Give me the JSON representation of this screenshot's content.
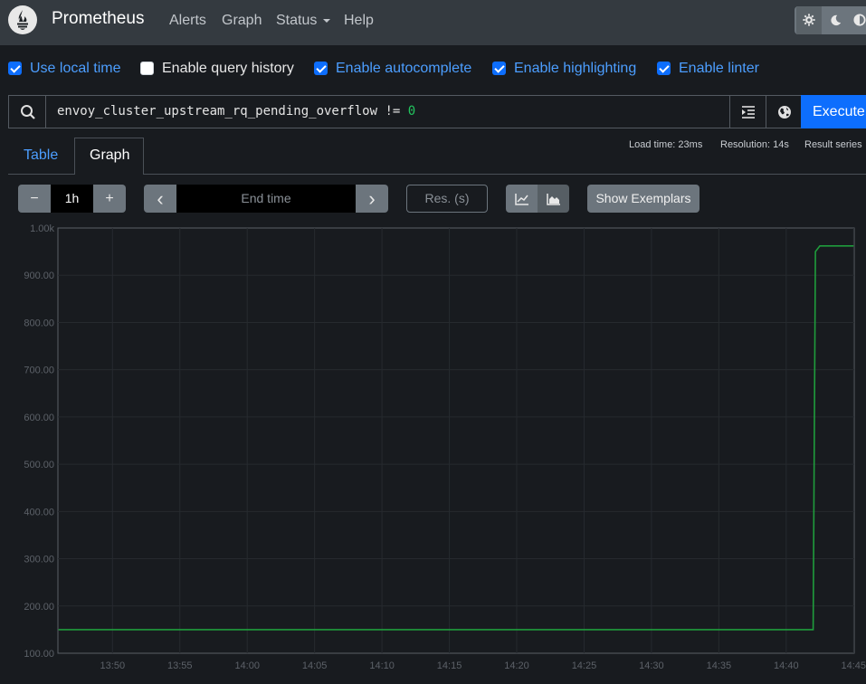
{
  "navbar": {
    "brand": "Prometheus",
    "links": [
      "Alerts",
      "Graph",
      "Status",
      "Help"
    ],
    "theme_icons": [
      "gear-icon",
      "moon-icon",
      "half-circle-icon"
    ]
  },
  "options": [
    {
      "label": "Use local time",
      "checked": true
    },
    {
      "label": "Enable query history",
      "checked": false
    },
    {
      "label": "Enable autocomplete",
      "checked": true
    },
    {
      "label": "Enable highlighting",
      "checked": true
    },
    {
      "label": "Enable linter",
      "checked": true
    }
  ],
  "query": {
    "metric": "envoy_cluster_upstream_rq_pending_overflow",
    "operator": "!=",
    "value": "0",
    "execute_label": "Execute"
  },
  "tabs": {
    "table": "Table",
    "graph": "Graph",
    "active": "Graph"
  },
  "meta": {
    "load_time": "Load time: 23ms",
    "resolution": "Resolution: 14s",
    "result_series": "Result series"
  },
  "controls": {
    "range": "1h",
    "end_time_placeholder": "End time",
    "res_placeholder": "Res. (s)",
    "exemplars_label": "Show Exemplars",
    "minus": "−",
    "plus": "+",
    "prev": "‹",
    "next": "›"
  },
  "colors": {
    "navbar": "#343a40",
    "accent": "#0d6efd",
    "series_line": "#1f9d3c",
    "number_highlight": "#22c55e"
  },
  "chart_data": {
    "type": "line",
    "y_ticks": [
      "100.00",
      "200.00",
      "300.00",
      "400.00",
      "500.00",
      "600.00",
      "700.00",
      "800.00",
      "900.00",
      "1.00k"
    ],
    "x_ticks": [
      "13:50",
      "13:55",
      "14:00",
      "14:05",
      "14:10",
      "14:15",
      "14:20",
      "14:25",
      "14:30",
      "14:35",
      "14:40",
      "14:45"
    ],
    "ylim": [
      100,
      1000
    ],
    "grid": true,
    "series": [
      {
        "points": [
          {
            "x": "13:46",
            "y": 150
          },
          {
            "x": "14:42",
            "y": 150
          },
          {
            "x": "14:42:10",
            "y": 950
          },
          {
            "x": "14:42:30",
            "y": 962
          },
          {
            "x": "14:45",
            "y": 962
          }
        ]
      }
    ]
  }
}
